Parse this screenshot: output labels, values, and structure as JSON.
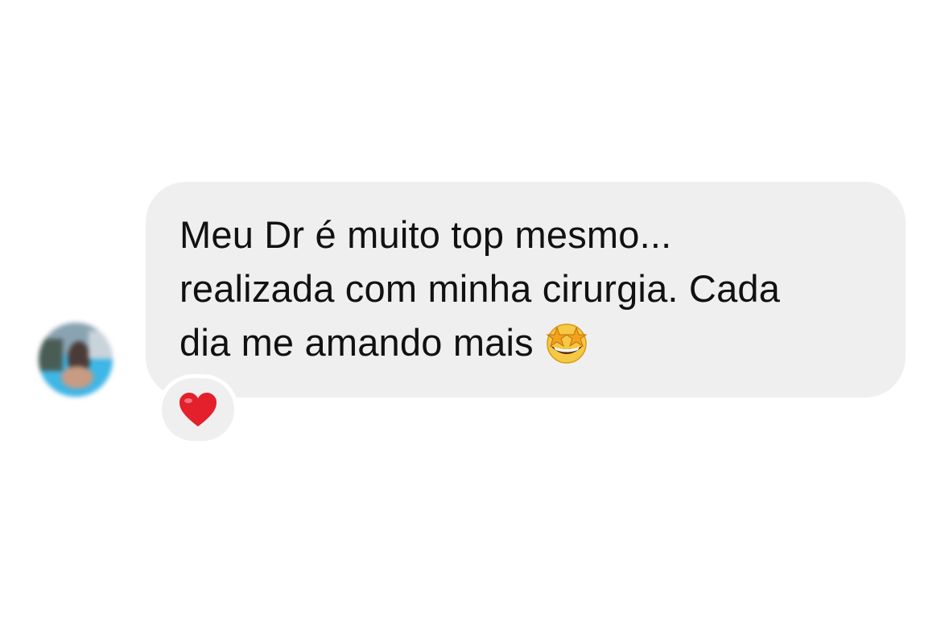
{
  "message": {
    "text": "Meu Dr é muito top mesmo...\nrealizada com minha cirurgia. Cada\ndia me amando mais",
    "trailing_emoji": "star-struck-emoji",
    "bubble_color": "#efefef",
    "text_color": "#111111"
  },
  "reaction": {
    "emoji": "red-heart-emoji",
    "color": "#e3202c"
  },
  "avatar": {
    "style": "blurred-profile-photo"
  }
}
